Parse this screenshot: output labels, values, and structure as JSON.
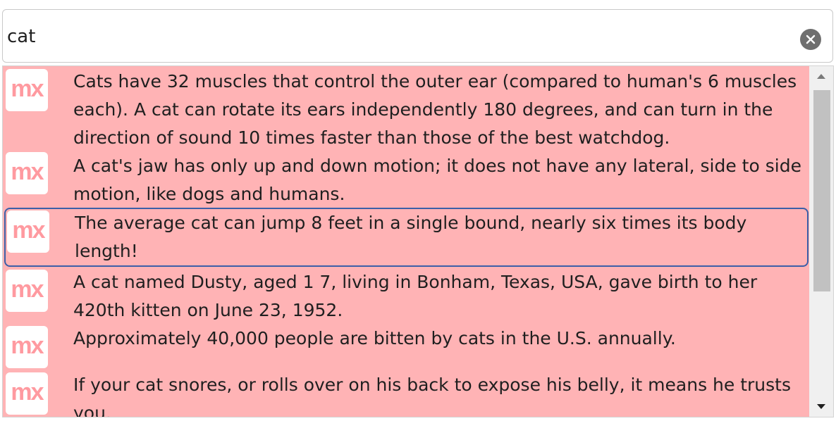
{
  "search": {
    "value": "cat",
    "placeholder": ""
  },
  "results": {
    "items": [
      {
        "logo": "mx",
        "text": "Cats have 32 muscles that control the outer ear (compared to human's 6 muscles each). A cat can rotate its ears independently 180 degrees, and can turn in the direction of sound 10 times faster than those of the best watchdog."
      },
      {
        "logo": "mx",
        "text": "A cat's jaw has only up and down motion; it does not have any lateral, side to side motion, like dogs and humans."
      },
      {
        "logo": "mx",
        "text": "The average cat can jump 8 feet in a single bound, nearly six times its body length!"
      },
      {
        "logo": "mx",
        "text": "A cat named Dusty, aged 1 7, living in Bonham, Texas, USA, gave birth to her 420th kitten on June 23, 1952."
      },
      {
        "logo": "mx",
        "text": "Approximately 40,000 people are bitten by cats in the U.S. annually."
      },
      {
        "logo": "mx",
        "text": "If your cat snores, or rolls over on his back to expose his belly, it means he trusts you."
      }
    ],
    "selected_index": 2
  },
  "colors": {
    "list_background": "#ffb3b5",
    "logo_text": "#ff9aa0",
    "selection_border": "#3b5fa8"
  }
}
